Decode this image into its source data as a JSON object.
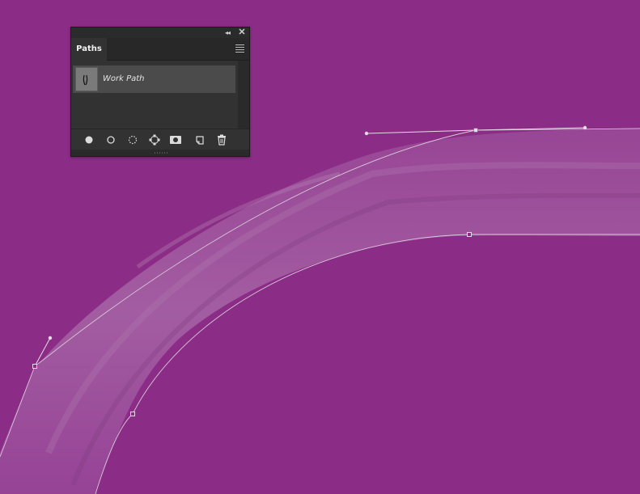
{
  "canvas": {
    "background_color": "#8b2d86",
    "stroke_color": "#a35aa2",
    "path_line_color": "#d8c8d8"
  },
  "panel": {
    "tab_label": "Paths",
    "collapse_glyph": "◂◂",
    "close_glyph": "✕",
    "menu_icon": "hamburger-menu-icon",
    "items": [
      {
        "label": "Work Path",
        "thumb_icon": "path-thumbnail-icon"
      }
    ],
    "footer_buttons": [
      {
        "name": "fill-path-icon"
      },
      {
        "name": "stroke-path-icon"
      },
      {
        "name": "load-as-selection-icon"
      },
      {
        "name": "make-work-path-icon"
      },
      {
        "name": "add-mask-icon"
      },
      {
        "name": "new-path-icon"
      },
      {
        "name": "delete-path-icon"
      }
    ]
  }
}
